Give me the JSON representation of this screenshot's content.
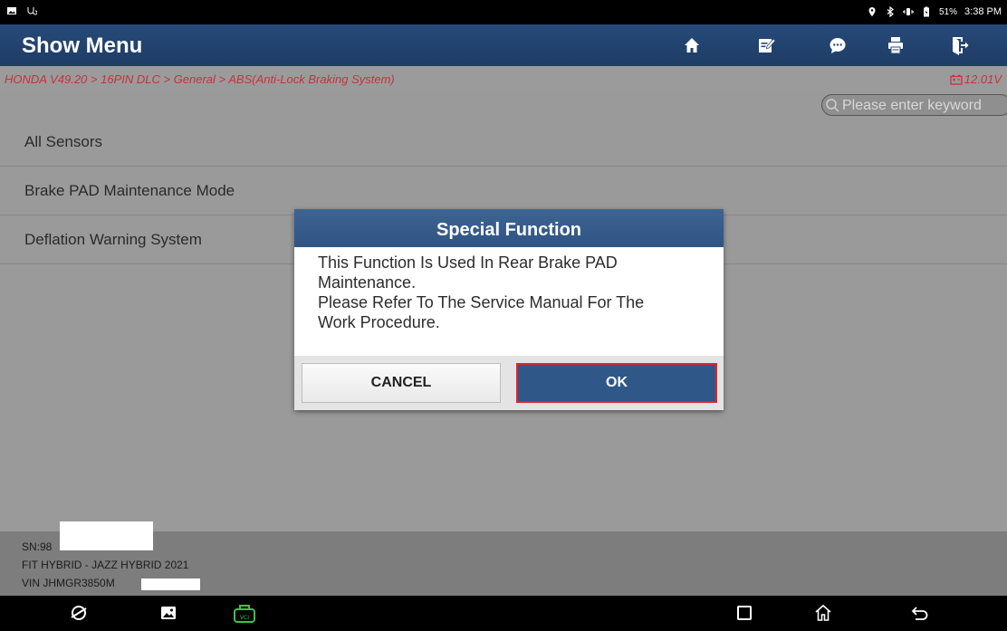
{
  "status_bar": {
    "battery": "51%",
    "time": "3:38 PM"
  },
  "header": {
    "title": "Show Menu",
    "buttons": [
      "home-icon",
      "edit-icon",
      "chat-icon",
      "print-icon",
      "exit-icon"
    ]
  },
  "breadcrumb": {
    "path": "HONDA V49.20 > 16PIN DLC > General > ABS(Anti-Lock Braking System)",
    "voltage": "12.01V"
  },
  "search": {
    "placeholder": "Please enter keyword"
  },
  "menu": {
    "items": [
      {
        "label": "All Sensors"
      },
      {
        "label": "Brake PAD Maintenance Mode"
      },
      {
        "label": "Deflation Warning System"
      }
    ]
  },
  "footer": {
    "sn": "SN:98",
    "vehicle": "FIT HYBRID - JAZZ HYBRID 2021",
    "vin": "VIN JHMGR3850M"
  },
  "dialog": {
    "title": "Special Function",
    "message": "This Function Is Used In Rear Brake PAD\nMaintenance.\nPlease Refer To The Service Manual For The\nWork Procedure.",
    "cancel_label": "CANCEL",
    "ok_label": "OK"
  },
  "colors": {
    "header": "#274a78",
    "breadcrumb_text": "#c4333b",
    "ok_border": "#e0242f",
    "vci_icon": "#3cc24a"
  }
}
